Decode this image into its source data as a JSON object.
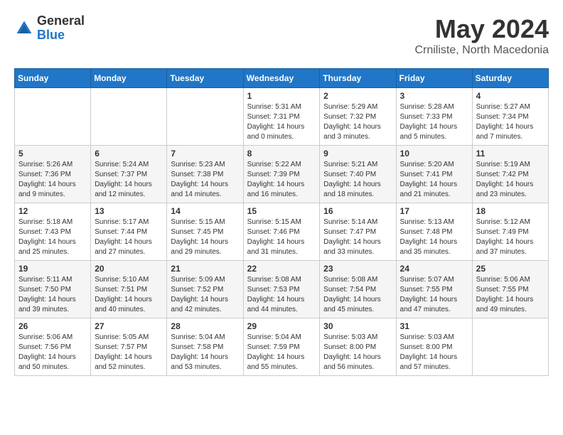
{
  "logo": {
    "general": "General",
    "blue": "Blue"
  },
  "header": {
    "month_year": "May 2024",
    "location": "Crniliste, North Macedonia"
  },
  "days_of_week": [
    "Sunday",
    "Monday",
    "Tuesday",
    "Wednesday",
    "Thursday",
    "Friday",
    "Saturday"
  ],
  "weeks": [
    [
      {
        "day": "",
        "info": ""
      },
      {
        "day": "",
        "info": ""
      },
      {
        "day": "",
        "info": ""
      },
      {
        "day": "1",
        "info": "Sunrise: 5:31 AM\nSunset: 7:31 PM\nDaylight: 14 hours\nand 0 minutes."
      },
      {
        "day": "2",
        "info": "Sunrise: 5:29 AM\nSunset: 7:32 PM\nDaylight: 14 hours\nand 3 minutes."
      },
      {
        "day": "3",
        "info": "Sunrise: 5:28 AM\nSunset: 7:33 PM\nDaylight: 14 hours\nand 5 minutes."
      },
      {
        "day": "4",
        "info": "Sunrise: 5:27 AM\nSunset: 7:34 PM\nDaylight: 14 hours\nand 7 minutes."
      }
    ],
    [
      {
        "day": "5",
        "info": "Sunrise: 5:26 AM\nSunset: 7:36 PM\nDaylight: 14 hours\nand 9 minutes."
      },
      {
        "day": "6",
        "info": "Sunrise: 5:24 AM\nSunset: 7:37 PM\nDaylight: 14 hours\nand 12 minutes."
      },
      {
        "day": "7",
        "info": "Sunrise: 5:23 AM\nSunset: 7:38 PM\nDaylight: 14 hours\nand 14 minutes."
      },
      {
        "day": "8",
        "info": "Sunrise: 5:22 AM\nSunset: 7:39 PM\nDaylight: 14 hours\nand 16 minutes."
      },
      {
        "day": "9",
        "info": "Sunrise: 5:21 AM\nSunset: 7:40 PM\nDaylight: 14 hours\nand 18 minutes."
      },
      {
        "day": "10",
        "info": "Sunrise: 5:20 AM\nSunset: 7:41 PM\nDaylight: 14 hours\nand 21 minutes."
      },
      {
        "day": "11",
        "info": "Sunrise: 5:19 AM\nSunset: 7:42 PM\nDaylight: 14 hours\nand 23 minutes."
      }
    ],
    [
      {
        "day": "12",
        "info": "Sunrise: 5:18 AM\nSunset: 7:43 PM\nDaylight: 14 hours\nand 25 minutes."
      },
      {
        "day": "13",
        "info": "Sunrise: 5:17 AM\nSunset: 7:44 PM\nDaylight: 14 hours\nand 27 minutes."
      },
      {
        "day": "14",
        "info": "Sunrise: 5:15 AM\nSunset: 7:45 PM\nDaylight: 14 hours\nand 29 minutes."
      },
      {
        "day": "15",
        "info": "Sunrise: 5:15 AM\nSunset: 7:46 PM\nDaylight: 14 hours\nand 31 minutes."
      },
      {
        "day": "16",
        "info": "Sunrise: 5:14 AM\nSunset: 7:47 PM\nDaylight: 14 hours\nand 33 minutes."
      },
      {
        "day": "17",
        "info": "Sunrise: 5:13 AM\nSunset: 7:48 PM\nDaylight: 14 hours\nand 35 minutes."
      },
      {
        "day": "18",
        "info": "Sunrise: 5:12 AM\nSunset: 7:49 PM\nDaylight: 14 hours\nand 37 minutes."
      }
    ],
    [
      {
        "day": "19",
        "info": "Sunrise: 5:11 AM\nSunset: 7:50 PM\nDaylight: 14 hours\nand 39 minutes."
      },
      {
        "day": "20",
        "info": "Sunrise: 5:10 AM\nSunset: 7:51 PM\nDaylight: 14 hours\nand 40 minutes."
      },
      {
        "day": "21",
        "info": "Sunrise: 5:09 AM\nSunset: 7:52 PM\nDaylight: 14 hours\nand 42 minutes."
      },
      {
        "day": "22",
        "info": "Sunrise: 5:08 AM\nSunset: 7:53 PM\nDaylight: 14 hours\nand 44 minutes."
      },
      {
        "day": "23",
        "info": "Sunrise: 5:08 AM\nSunset: 7:54 PM\nDaylight: 14 hours\nand 45 minutes."
      },
      {
        "day": "24",
        "info": "Sunrise: 5:07 AM\nSunset: 7:55 PM\nDaylight: 14 hours\nand 47 minutes."
      },
      {
        "day": "25",
        "info": "Sunrise: 5:06 AM\nSunset: 7:55 PM\nDaylight: 14 hours\nand 49 minutes."
      }
    ],
    [
      {
        "day": "26",
        "info": "Sunrise: 5:06 AM\nSunset: 7:56 PM\nDaylight: 14 hours\nand 50 minutes."
      },
      {
        "day": "27",
        "info": "Sunrise: 5:05 AM\nSunset: 7:57 PM\nDaylight: 14 hours\nand 52 minutes."
      },
      {
        "day": "28",
        "info": "Sunrise: 5:04 AM\nSunset: 7:58 PM\nDaylight: 14 hours\nand 53 minutes."
      },
      {
        "day": "29",
        "info": "Sunrise: 5:04 AM\nSunset: 7:59 PM\nDaylight: 14 hours\nand 55 minutes."
      },
      {
        "day": "30",
        "info": "Sunrise: 5:03 AM\nSunset: 8:00 PM\nDaylight: 14 hours\nand 56 minutes."
      },
      {
        "day": "31",
        "info": "Sunrise: 5:03 AM\nSunset: 8:00 PM\nDaylight: 14 hours\nand 57 minutes."
      },
      {
        "day": "",
        "info": ""
      }
    ]
  ]
}
